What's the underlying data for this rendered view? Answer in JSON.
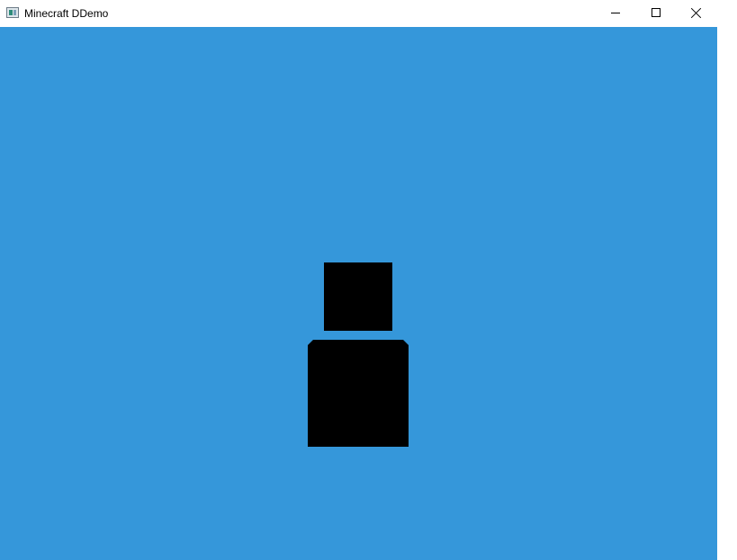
{
  "window": {
    "title": "Minecraft DDemo",
    "app_icon": "window-app-icon",
    "controls": {
      "minimize_icon": "minimize-icon",
      "maximize_icon": "maximize-icon",
      "close_icon": "close-icon"
    }
  },
  "scene": {
    "sky_color": "#3597da",
    "figure_color": "#000000",
    "figure_parts": [
      "head",
      "body"
    ]
  }
}
